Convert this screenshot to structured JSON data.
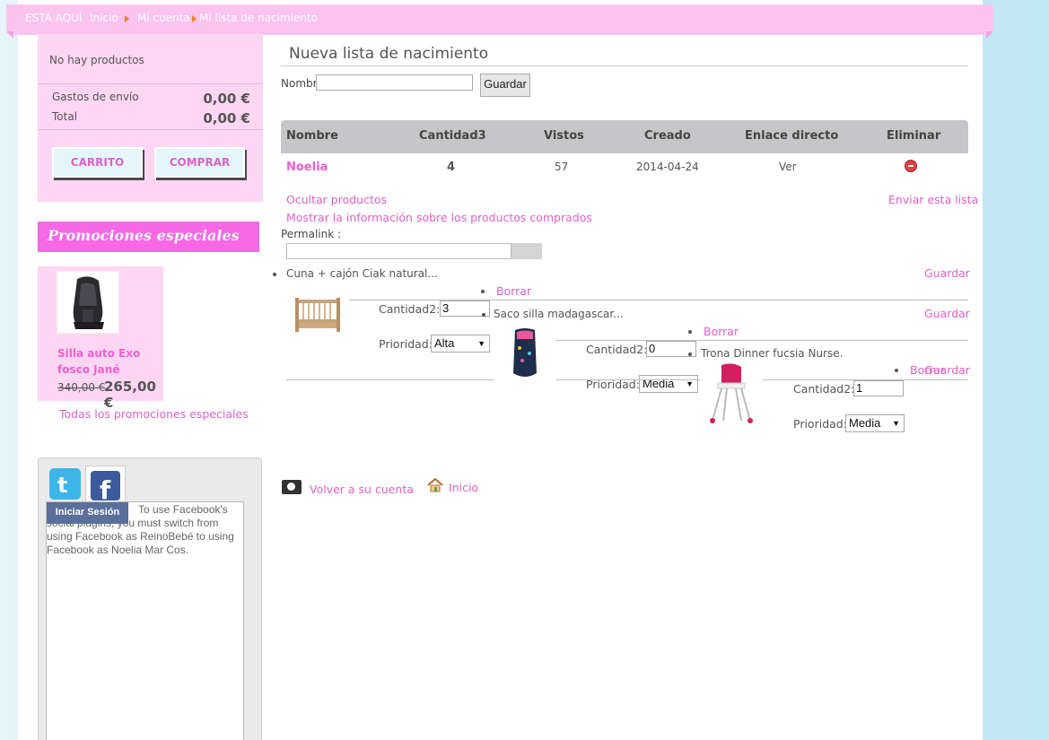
{
  "breadcrumb": {
    "here": "ESTÁ AQUÍ",
    "items": [
      "Inicio",
      "Mi cuenta",
      "Mi lista de nacimiento"
    ]
  },
  "cart": {
    "empty": "No hay productos",
    "shipping_label": "Gastos de envío",
    "shipping_value": "0,00 €",
    "total_label": "Total",
    "total_value": "0,00 €",
    "cart_button": "CARRITO",
    "buy_button": "COMPRAR"
  },
  "promotions": {
    "title": "Promociones especiales",
    "product_name": "Silla auto Exo fosco Jané",
    "old_price": "340,00 €",
    "new_price": "265,00 €",
    "all_link": "Todas los promociones especiales"
  },
  "social": {
    "twitter_icon": "twitter-icon",
    "facebook_icon": "facebook-icon",
    "login_button": "Iniciar Sesión",
    "message": "To use Facebook's social plugins, you must switch from using Facebook as ReinoBebé to using Facebook as Noelia Mar Cos."
  },
  "main": {
    "title": "Nueva lista de nacimiento",
    "name_label": "Nombre",
    "name_value": "",
    "save_button": "Guardar"
  },
  "table": {
    "headers": [
      "Nombre",
      "Cantidad3",
      "Vistos",
      "Creado",
      "Enlace directo",
      "Eliminar"
    ],
    "row": {
      "name": "Noelia",
      "quantity": "4",
      "views": "57",
      "created": "2014-04-24",
      "link": "Ver"
    }
  },
  "links": {
    "hide_products": "Ocultar productos",
    "send_list": "Enviar esta lista",
    "show_info": "Mostrar la información sobre los productos comprados",
    "permalink_label": "Permalink :",
    "permalink_value": ""
  },
  "items": [
    {
      "name": "Cuna + cajón Ciak natural...",
      "save": "Guardar",
      "delete": "Borrar",
      "qty_label": "Cantidad2:",
      "qty": "3",
      "prio_label": "Prioridad:",
      "priority": "Alta"
    },
    {
      "name": "Saco silla madagascar...",
      "save": "Guardar",
      "delete": "Borrar",
      "qty_label": "Cantidad2:",
      "qty": "0",
      "prio_label": "Prioridad:",
      "priority": "Media"
    },
    {
      "name": "Trona Dinner fucsia Nurse.",
      "save": "Guardar",
      "delete": "Borrar",
      "qty_label": "Cantidad2:",
      "qty": "1",
      "prio_label": "Prioridad:",
      "priority": "Media"
    }
  ],
  "footer": {
    "back_link": "Volver a su cuenta",
    "home_link": "Inicio"
  },
  "colors": {
    "accent": "#f668e6",
    "link": "#e060c8",
    "cart_bg": "#fdd6f3"
  }
}
